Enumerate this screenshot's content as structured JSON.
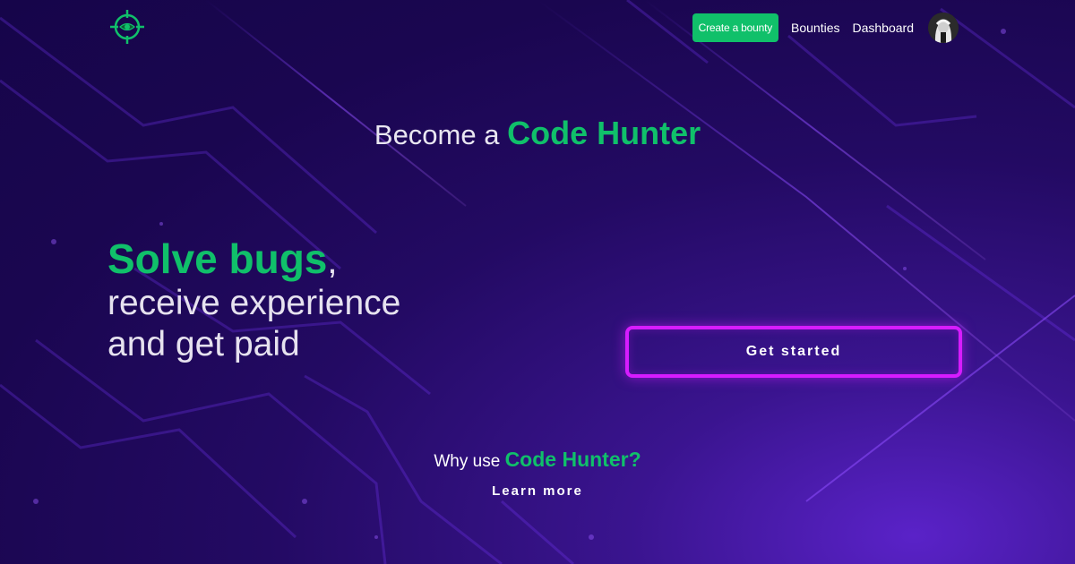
{
  "header": {
    "logo_icon": "crosshair-eye-icon",
    "nav": {
      "create_label": "Create a bounty",
      "bounties_label": "Bounties",
      "dashboard_label": "Dashboard"
    },
    "avatar_icon": "user-avatar"
  },
  "hero": {
    "tagline_prefix": "Become a",
    "tagline_brand": "Code Hunter",
    "headline_strong": "Solve bugs",
    "headline_comma": ",",
    "headline_line2": "receive experience",
    "headline_line3": "and get paid",
    "cta_label": "Get started"
  },
  "footer": {
    "why_prefix": "Why use",
    "why_brand": "Code Hunter?",
    "learn_more": "Learn more"
  },
  "colors": {
    "accent_green": "#10c06a",
    "accent_magenta": "#d61cff",
    "background": "#1a0650"
  }
}
